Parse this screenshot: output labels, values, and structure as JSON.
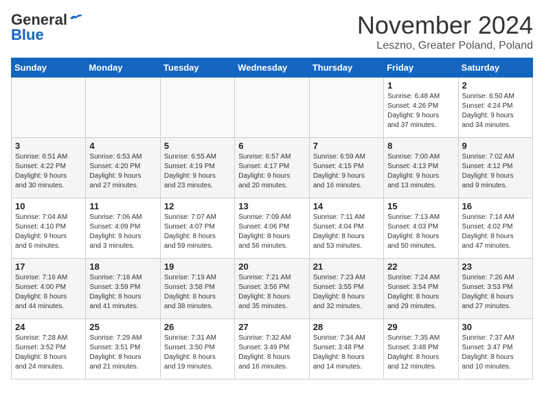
{
  "logo": {
    "general": "General",
    "blue": "Blue"
  },
  "title": "November 2024",
  "location": "Leszno, Greater Poland, Poland",
  "weekdays": [
    "Sunday",
    "Monday",
    "Tuesday",
    "Wednesday",
    "Thursday",
    "Friday",
    "Saturday"
  ],
  "weeks": [
    [
      {
        "day": "",
        "info": ""
      },
      {
        "day": "",
        "info": ""
      },
      {
        "day": "",
        "info": ""
      },
      {
        "day": "",
        "info": ""
      },
      {
        "day": "",
        "info": ""
      },
      {
        "day": "1",
        "info": "Sunrise: 6:48 AM\nSunset: 4:26 PM\nDaylight: 9 hours\nand 37 minutes."
      },
      {
        "day": "2",
        "info": "Sunrise: 6:50 AM\nSunset: 4:24 PM\nDaylight: 9 hours\nand 34 minutes."
      }
    ],
    [
      {
        "day": "3",
        "info": "Sunrise: 6:51 AM\nSunset: 4:22 PM\nDaylight: 9 hours\nand 30 minutes."
      },
      {
        "day": "4",
        "info": "Sunrise: 6:53 AM\nSunset: 4:20 PM\nDaylight: 9 hours\nand 27 minutes."
      },
      {
        "day": "5",
        "info": "Sunrise: 6:55 AM\nSunset: 4:19 PM\nDaylight: 9 hours\nand 23 minutes."
      },
      {
        "day": "6",
        "info": "Sunrise: 6:57 AM\nSunset: 4:17 PM\nDaylight: 9 hours\nand 20 minutes."
      },
      {
        "day": "7",
        "info": "Sunrise: 6:59 AM\nSunset: 4:15 PM\nDaylight: 9 hours\nand 16 minutes."
      },
      {
        "day": "8",
        "info": "Sunrise: 7:00 AM\nSunset: 4:13 PM\nDaylight: 9 hours\nand 13 minutes."
      },
      {
        "day": "9",
        "info": "Sunrise: 7:02 AM\nSunset: 4:12 PM\nDaylight: 9 hours\nand 9 minutes."
      }
    ],
    [
      {
        "day": "10",
        "info": "Sunrise: 7:04 AM\nSunset: 4:10 PM\nDaylight: 9 hours\nand 6 minutes."
      },
      {
        "day": "11",
        "info": "Sunrise: 7:06 AM\nSunset: 4:09 PM\nDaylight: 9 hours\nand 3 minutes."
      },
      {
        "day": "12",
        "info": "Sunrise: 7:07 AM\nSunset: 4:07 PM\nDaylight: 8 hours\nand 59 minutes."
      },
      {
        "day": "13",
        "info": "Sunrise: 7:09 AM\nSunset: 4:06 PM\nDaylight: 8 hours\nand 56 minutes."
      },
      {
        "day": "14",
        "info": "Sunrise: 7:11 AM\nSunset: 4:04 PM\nDaylight: 8 hours\nand 53 minutes."
      },
      {
        "day": "15",
        "info": "Sunrise: 7:13 AM\nSunset: 4:03 PM\nDaylight: 8 hours\nand 50 minutes."
      },
      {
        "day": "16",
        "info": "Sunrise: 7:14 AM\nSunset: 4:02 PM\nDaylight: 8 hours\nand 47 minutes."
      }
    ],
    [
      {
        "day": "17",
        "info": "Sunrise: 7:16 AM\nSunset: 4:00 PM\nDaylight: 8 hours\nand 44 minutes."
      },
      {
        "day": "18",
        "info": "Sunrise: 7:18 AM\nSunset: 3:59 PM\nDaylight: 8 hours\nand 41 minutes."
      },
      {
        "day": "19",
        "info": "Sunrise: 7:19 AM\nSunset: 3:58 PM\nDaylight: 8 hours\nand 38 minutes."
      },
      {
        "day": "20",
        "info": "Sunrise: 7:21 AM\nSunset: 3:56 PM\nDaylight: 8 hours\nand 35 minutes."
      },
      {
        "day": "21",
        "info": "Sunrise: 7:23 AM\nSunset: 3:55 PM\nDaylight: 8 hours\nand 32 minutes."
      },
      {
        "day": "22",
        "info": "Sunrise: 7:24 AM\nSunset: 3:54 PM\nDaylight: 8 hours\nand 29 minutes."
      },
      {
        "day": "23",
        "info": "Sunrise: 7:26 AM\nSunset: 3:53 PM\nDaylight: 8 hours\nand 27 minutes."
      }
    ],
    [
      {
        "day": "24",
        "info": "Sunrise: 7:28 AM\nSunset: 3:52 PM\nDaylight: 8 hours\nand 24 minutes."
      },
      {
        "day": "25",
        "info": "Sunrise: 7:29 AM\nSunset: 3:51 PM\nDaylight: 8 hours\nand 21 minutes."
      },
      {
        "day": "26",
        "info": "Sunrise: 7:31 AM\nSunset: 3:50 PM\nDaylight: 8 hours\nand 19 minutes."
      },
      {
        "day": "27",
        "info": "Sunrise: 7:32 AM\nSunset: 3:49 PM\nDaylight: 8 hours\nand 16 minutes."
      },
      {
        "day": "28",
        "info": "Sunrise: 7:34 AM\nSunset: 3:48 PM\nDaylight: 8 hours\nand 14 minutes."
      },
      {
        "day": "29",
        "info": "Sunrise: 7:35 AM\nSunset: 3:48 PM\nDaylight: 8 hours\nand 12 minutes."
      },
      {
        "day": "30",
        "info": "Sunrise: 7:37 AM\nSunset: 3:47 PM\nDaylight: 8 hours\nand 10 minutes."
      }
    ]
  ]
}
